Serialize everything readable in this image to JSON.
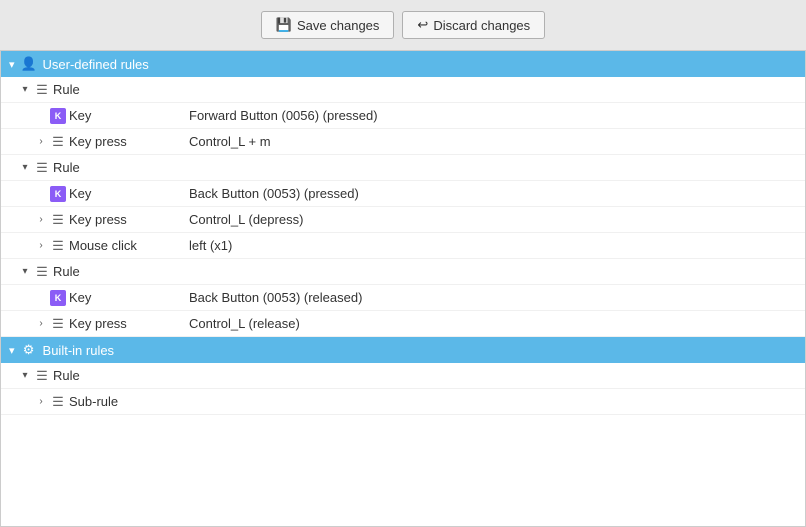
{
  "toolbar": {
    "save_label": "Save changes",
    "discard_label": "Discard changes",
    "save_icon": "💾",
    "discard_icon": "↩"
  },
  "sections": [
    {
      "id": "user-defined",
      "label": "User-defined rules",
      "expanded": true,
      "icon_type": "person",
      "rules": [
        {
          "id": "rule1",
          "label": "Rule",
          "expanded": true,
          "children": [
            {
              "type": "key",
              "label": "Key",
              "value": "Forward Button (0056) (pressed)"
            },
            {
              "type": "keypress",
              "label": "Key press",
              "value": "Control_L + m",
              "expanded": false
            }
          ]
        },
        {
          "id": "rule2",
          "label": "Rule",
          "expanded": true,
          "children": [
            {
              "type": "key",
              "label": "Key",
              "value": "Back Button (0053) (pressed)"
            },
            {
              "type": "keypress",
              "label": "Key press",
              "value": "Control_L  (depress)",
              "expanded": false
            },
            {
              "type": "mouseclick",
              "label": "Mouse click",
              "value": "left (x1)",
              "expanded": false
            }
          ]
        },
        {
          "id": "rule3",
          "label": "Rule",
          "expanded": true,
          "children": [
            {
              "type": "key",
              "label": "Key",
              "value": "Back Button (0053) (released)"
            },
            {
              "type": "keypress",
              "label": "Key press",
              "value": "Control_L  (release)",
              "expanded": false
            }
          ]
        }
      ]
    },
    {
      "id": "built-in",
      "label": "Built-in rules",
      "expanded": true,
      "icon_type": "gear",
      "rules": [
        {
          "id": "rule-bi-1",
          "label": "Rule",
          "expanded": true,
          "children": [
            {
              "type": "subrule",
              "label": "Sub-rule",
              "value": ""
            }
          ]
        }
      ]
    }
  ]
}
